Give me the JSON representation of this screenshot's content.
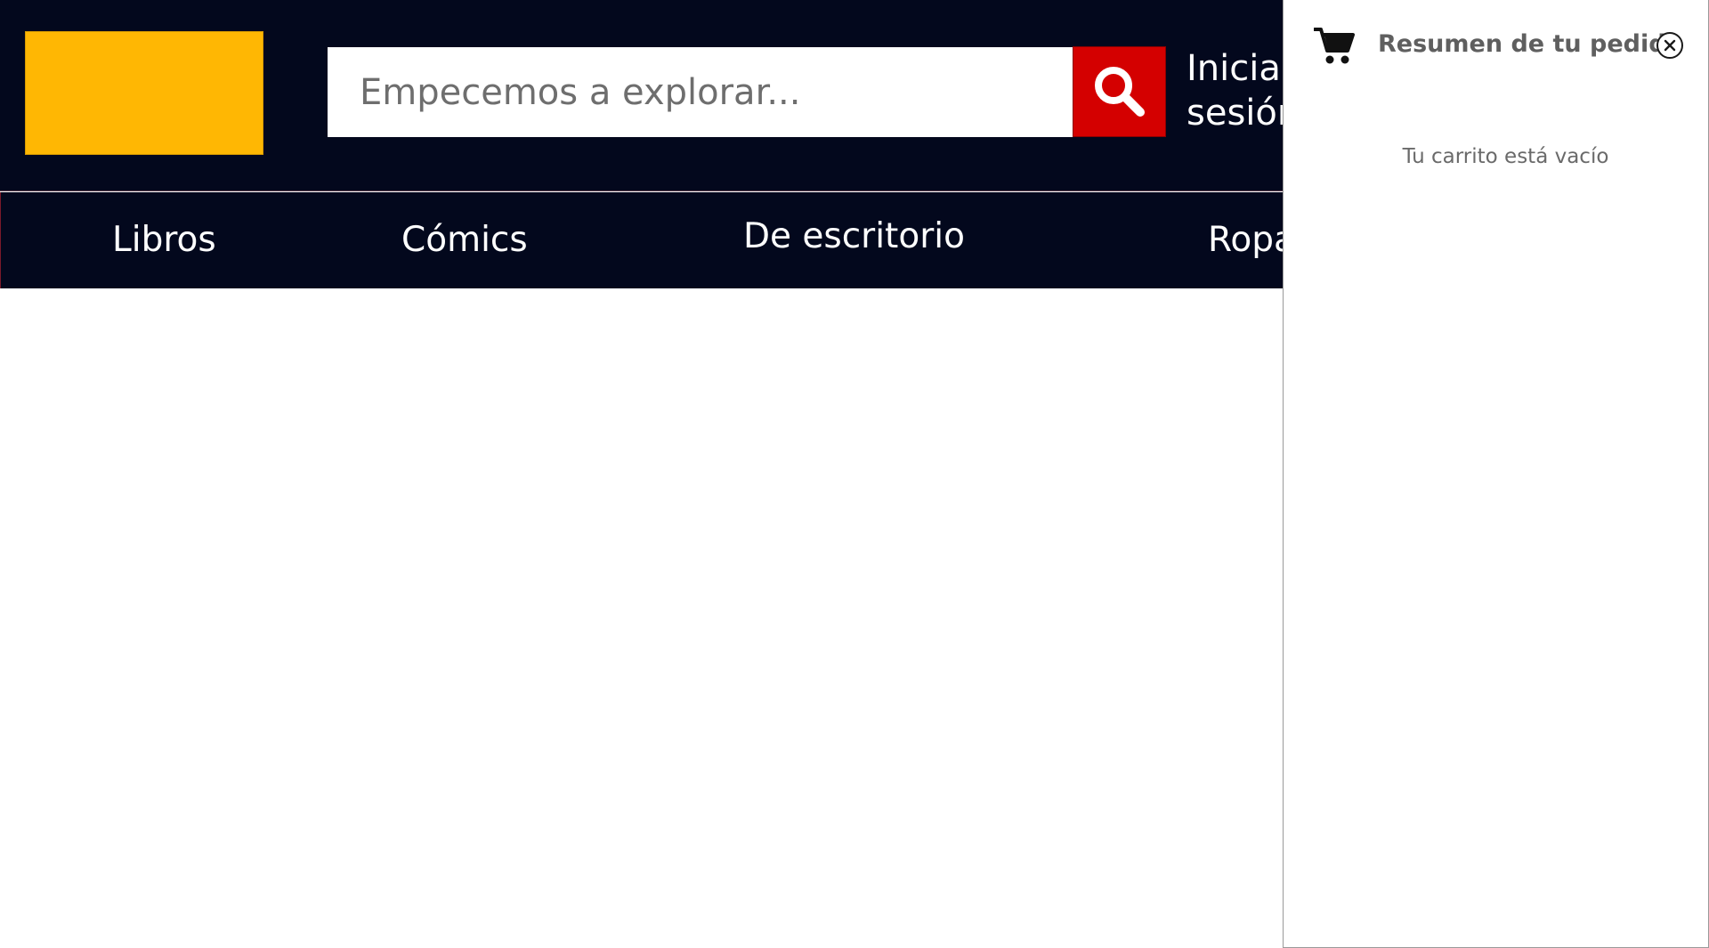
{
  "header": {
    "search": {
      "placeholder": "Empecemos a explorar..."
    },
    "login_label": "Inicia\nsesión",
    "colors": {
      "header_bg": "#03081d",
      "logo": "#ffb703",
      "search_button": "#d40000"
    }
  },
  "nav": {
    "items": [
      {
        "label": "Libros"
      },
      {
        "label": "Cómics"
      },
      {
        "label": "De escritorio"
      },
      {
        "label": "Ropa"
      }
    ]
  },
  "cart": {
    "title": "Resumen de tu pedido",
    "empty_message": "Tu carrito está vacío",
    "icons": {
      "cart": "shopping-cart-icon",
      "close": "close-circle-icon"
    }
  }
}
